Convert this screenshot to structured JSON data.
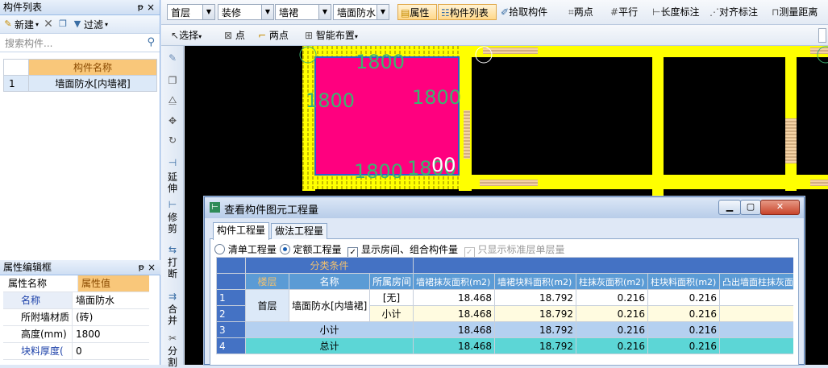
{
  "left_panel": {
    "component_list_title": "构件列表",
    "pin": "ᵽ",
    "close": "×",
    "toolbar": {
      "new_label": "新建",
      "filter_label": "过滤"
    },
    "search_placeholder": "搜索构件...",
    "table_header": "构件名称",
    "rows": [
      {
        "index": "1",
        "name": "墙面防水[内墙裙]"
      }
    ],
    "props_title": "属性编辑框",
    "props_header": {
      "name": "属性名称",
      "value": "属性值"
    },
    "props": [
      {
        "name": "名称",
        "value": "墙面防水"
      },
      {
        "name": "所附墙材质",
        "value": "(砖)"
      },
      {
        "name": "高度(mm)",
        "value": "1800"
      },
      {
        "name": "块料厚度(",
        "value": "0"
      }
    ]
  },
  "toolbar": {
    "floor": "首层",
    "category": "装修",
    "type": "墙裙",
    "component": "墙面防水[",
    "properties": "属性",
    "component_list": "构件列表",
    "pick": "拾取构件",
    "two_points": "两点",
    "parallel": "平行",
    "length_dim": "长度标注",
    "align_dim": "对齐标注",
    "measure": "测量距离"
  },
  "toolbar2": {
    "select": "选择",
    "point": "点",
    "two_points": "两点",
    "smart_layout": "智能布置"
  },
  "vertical_toolbar": {
    "extend": "延伸",
    "trim": "修剪",
    "break": "打断",
    "merge": "合并",
    "split": "分割"
  },
  "canvas": {
    "labels": [
      "1800",
      "1800",
      "1800",
      "1800",
      "1800",
      "1800",
      "00"
    ]
  },
  "dialog": {
    "title": "查看构件图元工程量",
    "tabs": [
      "构件工程量",
      "做法工程量"
    ],
    "options": {
      "list_qty": "清单工程量",
      "quota_qty": "定额工程量",
      "show_rooms": "显示房间、组合构件量",
      "std_floor_only": "只显示标准层单层量"
    },
    "table": {
      "group_header": "分类条件",
      "headers": [
        "楼层",
        "名称",
        "所属房间",
        "墙裙抹灰面积(m2)",
        "墙裙块料面积(m2)",
        "柱抹灰面积(m2)",
        "柱块料面积(m2)",
        "凸出墙面柱抹灰面"
      ],
      "rows": [
        {
          "n": "1",
          "floor": "首层",
          "name": "墙面防水[内墙裙]",
          "room": "[无]",
          "v1": "18.468",
          "v2": "18.792",
          "v3": "0.216",
          "v4": "0.216"
        },
        {
          "n": "2",
          "room": "小计",
          "v1": "18.468",
          "v2": "18.792",
          "v3": "0.216",
          "v4": "0.216"
        },
        {
          "n": "3",
          "label": "小计",
          "v1": "18.468",
          "v2": "18.792",
          "v3": "0.216",
          "v4": "0.216"
        },
        {
          "n": "4",
          "label": "总计",
          "v1": "18.468",
          "v2": "18.792",
          "v3": "0.216",
          "v4": "0.216"
        }
      ]
    }
  },
  "colors": {
    "wall": "#ffff00",
    "waterproof": "#ff007f",
    "dim_text": "#3cb371",
    "accent": "#4472c4",
    "total_row": "#5cd6d6"
  }
}
